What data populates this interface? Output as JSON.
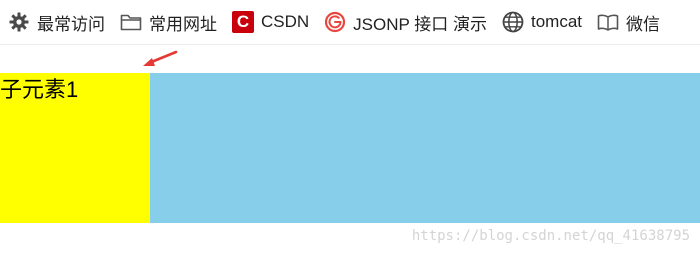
{
  "bookmarks": {
    "items": [
      {
        "label": "最常访问",
        "icon": "gear-icon"
      },
      {
        "label": "常用网址",
        "icon": "folder-icon"
      },
      {
        "label": "CSDN",
        "icon": "csdn-logo-icon"
      },
      {
        "label": "JSONP 接口 演示",
        "icon": "g-logo-icon"
      },
      {
        "label": "tomcat",
        "icon": "globe-icon"
      },
      {
        "label": "微信",
        "icon": "book-icon"
      }
    ]
  },
  "content": {
    "child_label": "子元素1",
    "container_color": "#87ceeb",
    "child_color": "#ffff00"
  },
  "annotation": {
    "arrow_color": "#e53935"
  },
  "watermark": {
    "text": "https://blog.csdn.net/qq_41638795"
  },
  "icons": {
    "csdn_glyph": "C"
  }
}
